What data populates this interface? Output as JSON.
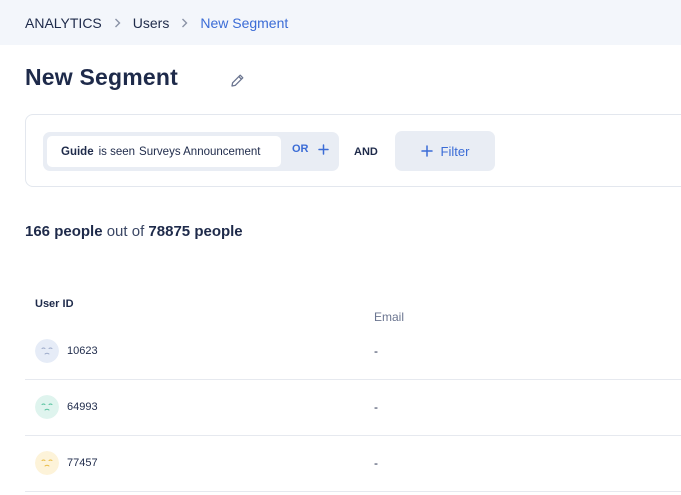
{
  "breadcrumb": {
    "items": [
      "ANALYTICS",
      "Users",
      "New Segment"
    ]
  },
  "page": {
    "title": "New Segment"
  },
  "filters": {
    "condition": {
      "field": "Guide",
      "operator": "is seen",
      "value": "Surveys Announcement"
    },
    "or_label": "OR",
    "and_label": "AND",
    "add_filter_label": "Filter"
  },
  "summary": {
    "matched": "166",
    "matched_unit": "people",
    "out_of": "out of",
    "total": "78875",
    "total_unit": "people"
  },
  "table": {
    "columns": [
      "User ID",
      "Email"
    ],
    "rows": [
      {
        "user_id": "10623",
        "email": "-",
        "avatar_color": "#e6ecf7",
        "avatar_stroke": "#9aa8c8"
      },
      {
        "user_id": "64993",
        "email": "-",
        "avatar_color": "#dff4ee",
        "avatar_stroke": "#4fbf9a"
      },
      {
        "user_id": "77457",
        "email": "-",
        "avatar_color": "#fdf3d9",
        "avatar_stroke": "#e9b93c"
      }
    ]
  },
  "colors": {
    "accent": "#3b6cd6",
    "text": "#1e2a4a",
    "breadcrumb_bg": "#f3f6fb",
    "chip_bg": "#e9edf4"
  }
}
